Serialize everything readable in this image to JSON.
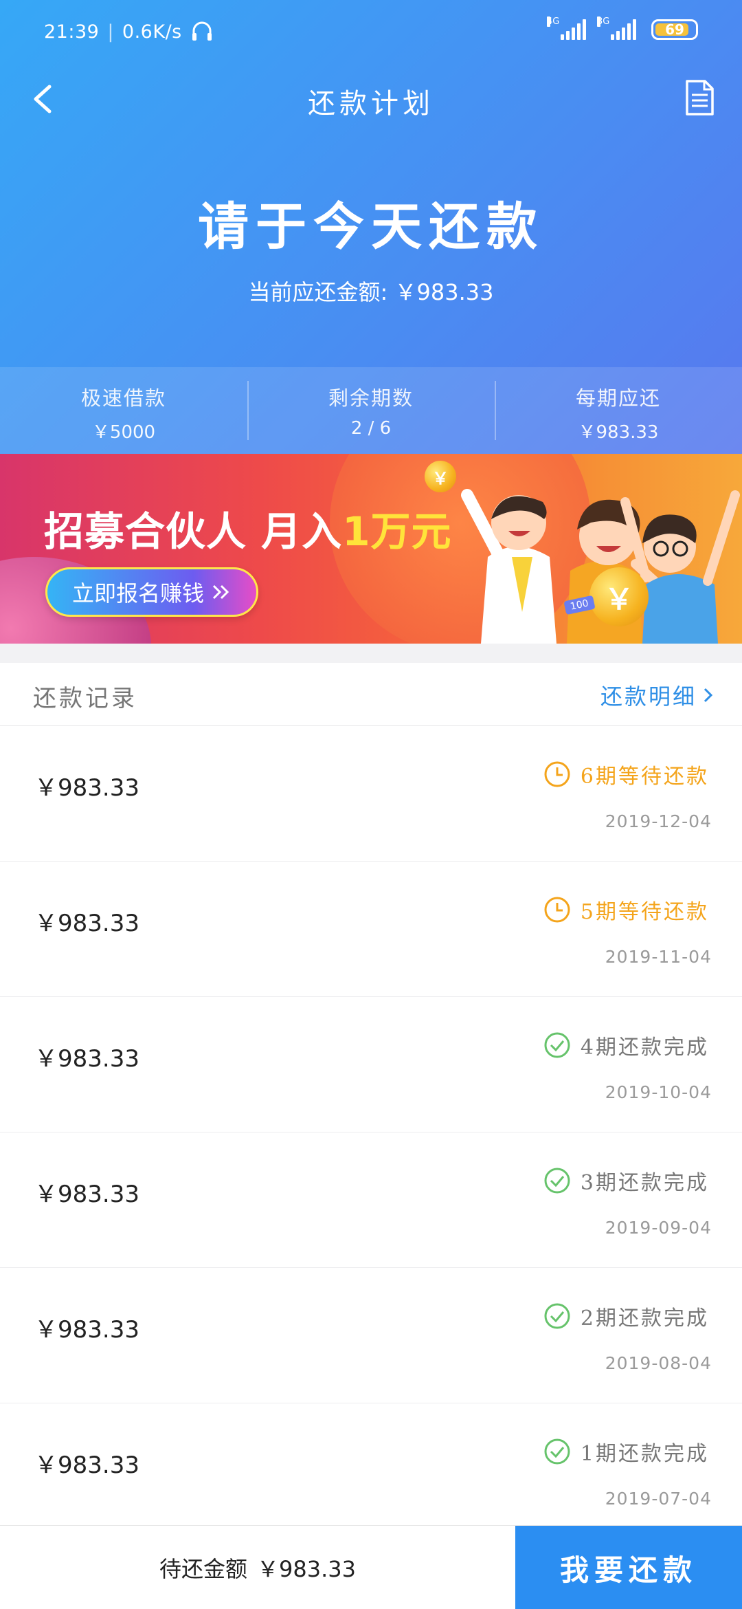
{
  "status_bar": {
    "time": "21:39",
    "net_speed": "0.6K/s",
    "sim1_type": "4G",
    "sim2_type": "3G",
    "battery": "69"
  },
  "nav": {
    "title": "还款计划"
  },
  "hero": {
    "title": "请于今天还款",
    "amount_label": "当前应还金额:",
    "amount_value": "￥983.33"
  },
  "stats": [
    {
      "label": "极速借款",
      "value": "￥5000"
    },
    {
      "label": "剩余期数",
      "value": "2 / 6"
    },
    {
      "label": "每期应还",
      "value": "￥983.33"
    }
  ],
  "banner": {
    "title_main": "招募合伙人 月入",
    "title_highlight": "1万元",
    "button_label": "立即报名赚钱",
    "coin_symbol": "￥",
    "coin_small_label": "100"
  },
  "records": {
    "title": "还款记录",
    "detail_link": "还款明细",
    "items": [
      {
        "amount": "￥983.33",
        "status": "6期等待还款",
        "state": "pending",
        "date": "2019-12-04"
      },
      {
        "amount": "￥983.33",
        "status": "5期等待还款",
        "state": "pending",
        "date": "2019-11-04"
      },
      {
        "amount": "￥983.33",
        "status": "4期还款完成",
        "state": "done",
        "date": "2019-10-04"
      },
      {
        "amount": "￥983.33",
        "status": "3期还款完成",
        "state": "done",
        "date": "2019-09-04"
      },
      {
        "amount": "￥983.33",
        "status": "2期还款完成",
        "state": "done",
        "date": "2019-08-04"
      },
      {
        "amount": "￥983.33",
        "status": "1期还款完成",
        "state": "done",
        "date": "2019-07-04"
      }
    ]
  },
  "footer": {
    "due_label": "待还金额",
    "due_amount": "￥983.33",
    "pay_button": "我要还款"
  },
  "colors": {
    "header_start": "#36a8f6",
    "header_end": "#5878ee",
    "pending": "#f4a41b",
    "done": "#66c36b",
    "link": "#2f8fe6",
    "pay_button": "#2b8ef2"
  }
}
